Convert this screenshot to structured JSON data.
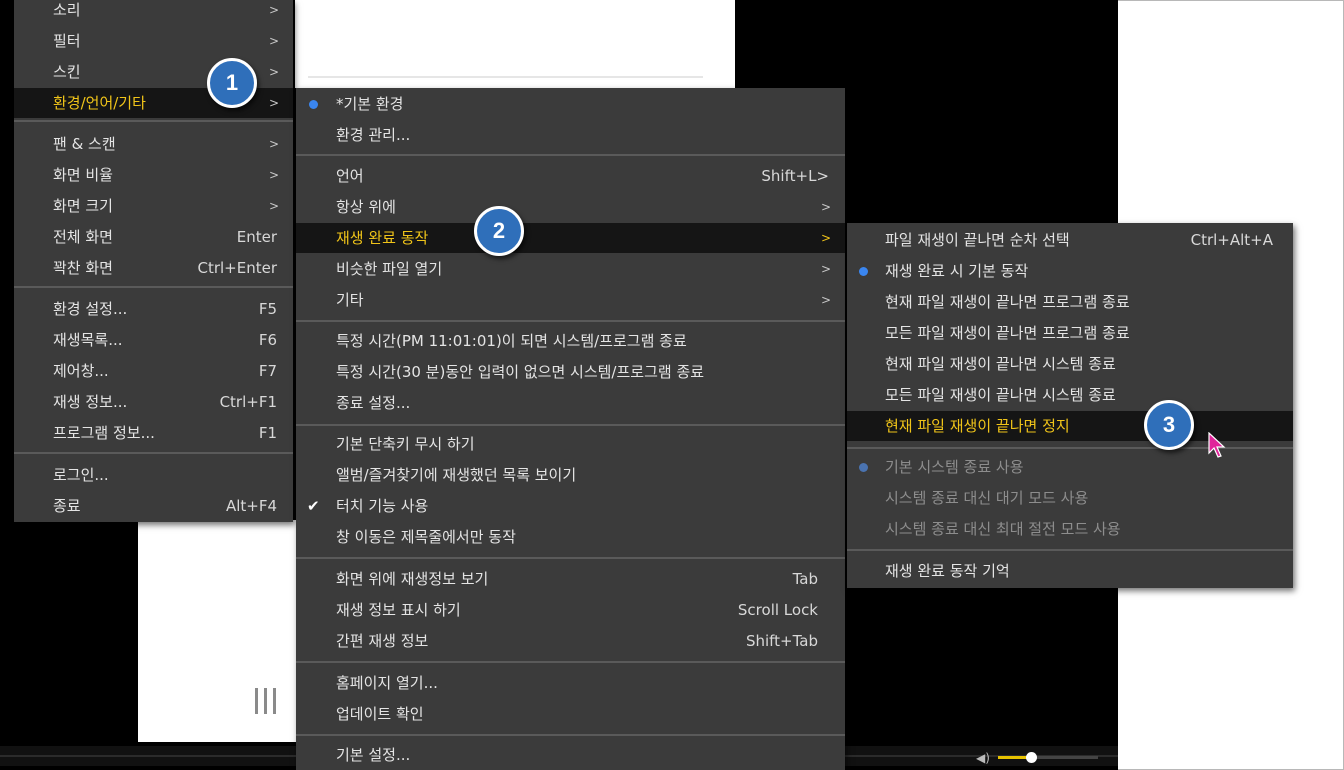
{
  "menu1": {
    "items": [
      {
        "label": "소리",
        "arrow": ">"
      },
      {
        "label": "필터",
        "arrow": ">"
      },
      {
        "label": "스킨",
        "arrow": ">"
      },
      {
        "label": "환경/언어/기타",
        "arrow": ">"
      },
      {
        "label": "팬 & 스캔",
        "arrow": ">"
      },
      {
        "label": "화면 비율",
        "arrow": ">"
      },
      {
        "label": "화면 크기",
        "arrow": ">"
      },
      {
        "label": "전체 화면",
        "shortcut": "Enter"
      },
      {
        "label": "꽉찬 화면",
        "shortcut": "Ctrl+Enter"
      },
      {
        "label": "환경 설정...",
        "shortcut": "F5"
      },
      {
        "label": "재생목록...",
        "shortcut": "F6"
      },
      {
        "label": "제어창...",
        "shortcut": "F7"
      },
      {
        "label": "재생 정보...",
        "shortcut": "Ctrl+F1"
      },
      {
        "label": "프로그램 정보...",
        "shortcut": "F1"
      },
      {
        "label": "로그인..."
      },
      {
        "label": "종료",
        "shortcut": "Alt+F4"
      }
    ]
  },
  "menu2": {
    "items": [
      {
        "label": "*기본 환경",
        "radio": true
      },
      {
        "label": "환경 관리..."
      },
      {
        "label": "언어",
        "shortcut": "Shift+L>"
      },
      {
        "label": "항상 위에",
        "arrow": ">"
      },
      {
        "label": "재생 완료 동작",
        "arrow": ">"
      },
      {
        "label": "비슷한 파일 열기",
        "arrow": ">"
      },
      {
        "label": "기타",
        "arrow": ">"
      },
      {
        "label": "특정 시간(PM 11:01:01)이 되면 시스템/프로그램 종료"
      },
      {
        "label": "특정 시간(30 분)동안 입력이 없으면 시스템/프로그램 종료"
      },
      {
        "label": "종료 설정..."
      },
      {
        "label": "기본 단축키 무시 하기"
      },
      {
        "label": "앨범/즐겨찾기에 재생했던 목록 보이기"
      },
      {
        "label": "터치 기능 사용",
        "check": "✔"
      },
      {
        "label": "창 이동은 제목줄에서만 동작"
      },
      {
        "label": "화면 위에 재생정보 보기",
        "shortcut": "Tab"
      },
      {
        "label": "재생 정보 표시 하기",
        "shortcut": "Scroll Lock"
      },
      {
        "label": "간편 재생 정보",
        "shortcut": "Shift+Tab"
      },
      {
        "label": "홈페이지 열기..."
      },
      {
        "label": "업데이트 확인"
      },
      {
        "label": "기본 설정..."
      }
    ]
  },
  "menu3": {
    "items": [
      {
        "label": "파일 재생이 끝나면 순차 선택",
        "shortcut": "Ctrl+Alt+A"
      },
      {
        "label": "재생 완료 시 기본 동작",
        "radio": true
      },
      {
        "label": "현재 파일 재생이 끝나면 프로그램 종료"
      },
      {
        "label": "모든 파일 재생이 끝나면 프로그램 종료"
      },
      {
        "label": "현재 파일 재생이 끝나면 시스템 종료"
      },
      {
        "label": "모든 파일 재생이 끝나면 시스템 종료"
      },
      {
        "label": "현재 파일 재생이 끝나면 정지"
      },
      {
        "label": "기본 시스템 종료 사용",
        "radio": true,
        "disabled": true
      },
      {
        "label": "시스템 종료 대신 대기 모드 사용",
        "disabled": true
      },
      {
        "label": "시스템 종료 대신 최대 절전 모드 사용",
        "disabled": true
      },
      {
        "label": "재생 완료 동작 기억"
      }
    ]
  },
  "badges": [
    "1",
    "2",
    "3"
  ],
  "player": {
    "volume_level": 0.33
  },
  "colors": {
    "highlight_text": "#f0c419",
    "menu_bg": "#3b3b3b",
    "badge": "#2f6fba",
    "radio": "#3a86f0",
    "cursor": "#e0249a"
  }
}
